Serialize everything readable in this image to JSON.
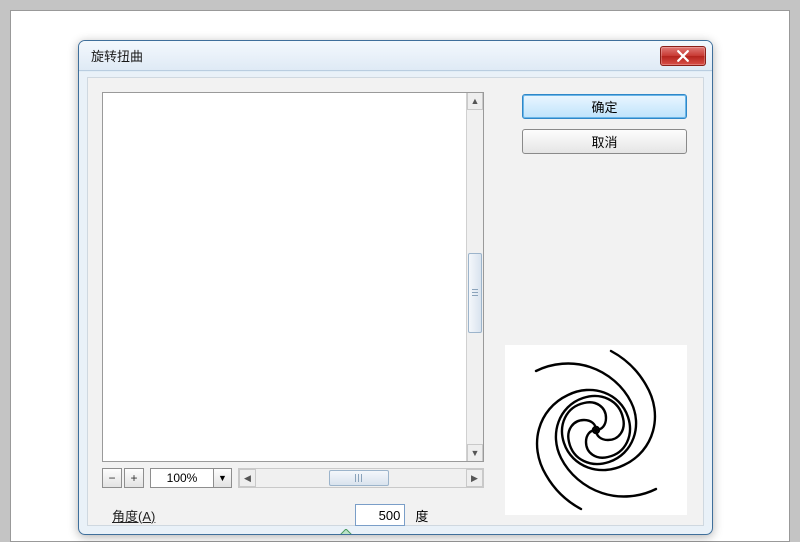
{
  "dialog": {
    "title": "旋转扭曲",
    "close_icon": "close-icon"
  },
  "buttons": {
    "ok": "确定",
    "cancel": "取消"
  },
  "zoom": {
    "minus": "−",
    "plus": "+",
    "value": "100%",
    "drop": "▼"
  },
  "scroll": {
    "up": "▲",
    "down": "▼",
    "left": "◀",
    "right": "▶"
  },
  "angle": {
    "label": "角度(A)",
    "value": "500",
    "unit": "度"
  }
}
